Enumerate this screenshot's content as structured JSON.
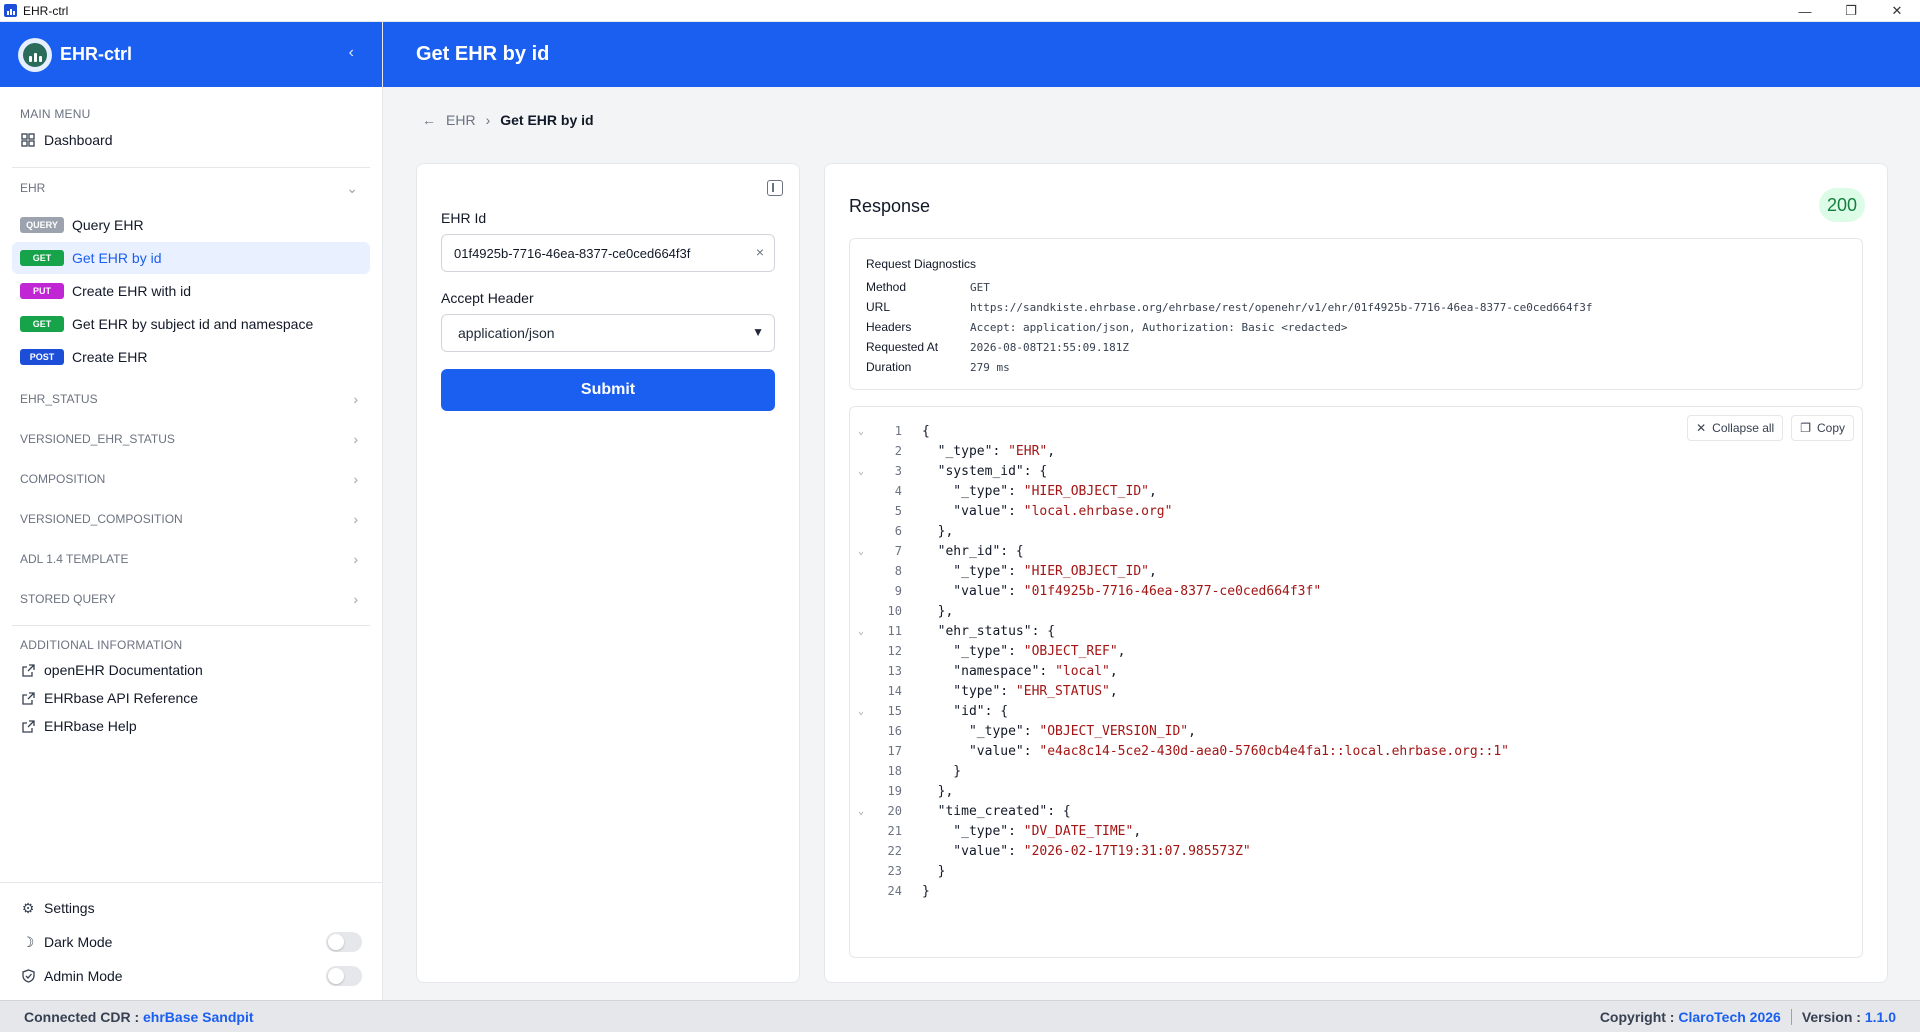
{
  "window": {
    "title": "EHR-ctrl"
  },
  "sidebar": {
    "brand": "EHR-ctrl",
    "main_menu_label": "MAIN MENU",
    "dashboard": "Dashboard",
    "ehr_label": "EHR",
    "ehr_items": [
      {
        "method": "QUERY",
        "color": "#9ca3af",
        "label": "Query EHR"
      },
      {
        "method": "GET",
        "color": "#16a34a",
        "label": "Get EHR by id",
        "active": true
      },
      {
        "method": "PUT",
        "color": "#c026d3",
        "label": "Create EHR with id"
      },
      {
        "method": "GET",
        "color": "#16a34a",
        "label": "Get EHR by subject id and namespace"
      },
      {
        "method": "POST",
        "color": "#1d4ed8",
        "label": "Create EHR"
      }
    ],
    "groups": [
      "EHR_STATUS",
      "VERSIONED_EHR_STATUS",
      "COMPOSITION",
      "VERSIONED_COMPOSITION",
      "ADL 1.4 TEMPLATE",
      "STORED QUERY"
    ],
    "additional_label": "ADDITIONAL INFORMATION",
    "links": [
      "openEHR Documentation",
      "EHRbase API Reference",
      "EHRbase Help"
    ],
    "settings": "Settings",
    "dark_mode": "Dark Mode",
    "admin_mode": "Admin Mode"
  },
  "header": {
    "title": "Get EHR by id"
  },
  "breadcrumb": {
    "parent": "EHR",
    "current": "Get EHR by id"
  },
  "form": {
    "ehr_id_label": "EHR Id",
    "ehr_id_value": "01f4925b-7716-46ea-8377-ce0ced664f3f",
    "accept_label": "Accept Header",
    "accept_value": "application/json",
    "submit": "Submit"
  },
  "response": {
    "title": "Response",
    "status": "200",
    "diagnostics_title": "Request Diagnostics",
    "diagnostics": [
      {
        "k": "Method",
        "v": "GET"
      },
      {
        "k": "URL",
        "v": "https://sandkiste.ehrbase.org/ehrbase/rest/openehr/v1/ehr/01f4925b-7716-46ea-8377-ce0ced664f3f"
      },
      {
        "k": "Headers",
        "v": "Accept: application/json, Authorization: Basic <redacted>"
      },
      {
        "k": "Requested At",
        "v": "2026-08-08T21:55:09.181Z"
      },
      {
        "k": "Duration",
        "v": "279 ms"
      }
    ],
    "collapse_all": "Collapse all",
    "copy": "Copy",
    "code_lines": [
      {
        "fold": true,
        "pre": "{",
        "str": "",
        "post": ""
      },
      {
        "fold": false,
        "pre": "  \"_type\": ",
        "str": "\"EHR\"",
        "post": ","
      },
      {
        "fold": true,
        "pre": "  \"system_id\": {",
        "str": "",
        "post": ""
      },
      {
        "fold": false,
        "pre": "    \"_type\": ",
        "str": "\"HIER_OBJECT_ID\"",
        "post": ","
      },
      {
        "fold": false,
        "pre": "    \"value\": ",
        "str": "\"local.ehrbase.org\"",
        "post": ""
      },
      {
        "fold": false,
        "pre": "  },",
        "str": "",
        "post": ""
      },
      {
        "fold": true,
        "pre": "  \"ehr_id\": {",
        "str": "",
        "post": ""
      },
      {
        "fold": false,
        "pre": "    \"_type\": ",
        "str": "\"HIER_OBJECT_ID\"",
        "post": ","
      },
      {
        "fold": false,
        "pre": "    \"value\": ",
        "str": "\"01f4925b-7716-46ea-8377-ce0ced664f3f\"",
        "post": ""
      },
      {
        "fold": false,
        "pre": "  },",
        "str": "",
        "post": ""
      },
      {
        "fold": true,
        "pre": "  \"ehr_status\": {",
        "str": "",
        "post": ""
      },
      {
        "fold": false,
        "pre": "    \"_type\": ",
        "str": "\"OBJECT_REF\"",
        "post": ","
      },
      {
        "fold": false,
        "pre": "    \"namespace\": ",
        "str": "\"local\"",
        "post": ","
      },
      {
        "fold": false,
        "pre": "    \"type\": ",
        "str": "\"EHR_STATUS\"",
        "post": ","
      },
      {
        "fold": true,
        "pre": "    \"id\": {",
        "str": "",
        "post": ""
      },
      {
        "fold": false,
        "pre": "      \"_type\": ",
        "str": "\"OBJECT_VERSION_ID\"",
        "post": ","
      },
      {
        "fold": false,
        "pre": "      \"value\": ",
        "str": "\"e4ac8c14-5ce2-430d-aea0-5760cb4e4fa1::local.ehrbase.org::1\"",
        "post": ""
      },
      {
        "fold": false,
        "pre": "    }",
        "str": "",
        "post": ""
      },
      {
        "fold": false,
        "pre": "  },",
        "str": "",
        "post": ""
      },
      {
        "fold": true,
        "pre": "  \"time_created\": {",
        "str": "",
        "post": ""
      },
      {
        "fold": false,
        "pre": "    \"_type\": ",
        "str": "\"DV_DATE_TIME\"",
        "post": ","
      },
      {
        "fold": false,
        "pre": "    \"value\": ",
        "str": "\"2026-02-17T19:31:07.985573Z\"",
        "post": ""
      },
      {
        "fold": false,
        "pre": "  }",
        "str": "",
        "post": ""
      },
      {
        "fold": false,
        "pre": "}",
        "str": "",
        "post": ""
      }
    ]
  },
  "footer": {
    "connected_label": "Connected CDR :",
    "connected_value": "ehrBase Sandpit",
    "copyright_label": "Copyright :",
    "copyright_value": "ClaroTech 2026",
    "version_label": "Version :",
    "version_value": "1.1.0"
  }
}
